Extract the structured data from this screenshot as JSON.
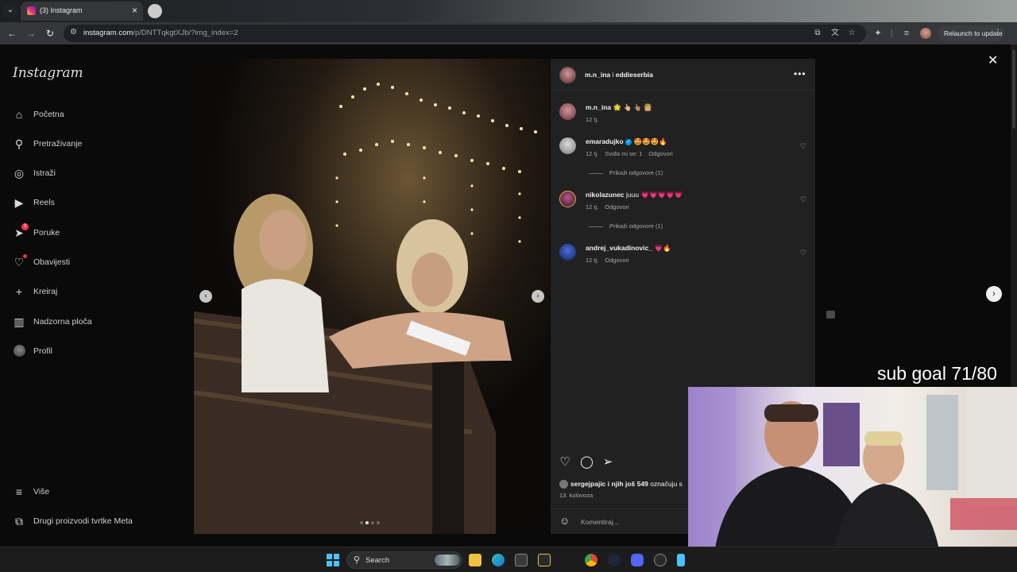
{
  "browser": {
    "tab_title": "(3) Instagram",
    "url_host": "instagram.com",
    "url_path": "/p/DNTTqkgtXJb/?img_index=2",
    "relaunch_label": "Relaunch to update"
  },
  "sidebar": {
    "logo": "Instagram",
    "items": [
      {
        "label": "Početna",
        "icon": "home-icon"
      },
      {
        "label": "Pretraživanje",
        "icon": "search-icon"
      },
      {
        "label": "Istraži",
        "icon": "compass-icon"
      },
      {
        "label": "Reels",
        "icon": "reels-icon"
      },
      {
        "label": "Poruke",
        "icon": "messenger-icon",
        "badge": "3"
      },
      {
        "label": "Obavijesti",
        "icon": "heart-icon"
      },
      {
        "label": "Kreiraj",
        "icon": "plus-icon"
      },
      {
        "label": "Nadzorna ploča",
        "icon": "dashboard-icon"
      },
      {
        "label": "Profil",
        "icon": "profile-icon"
      }
    ],
    "more_label": "Više",
    "meta_label": "Drugi proizvodi tvrtke Meta"
  },
  "post": {
    "author": "m.n_ina",
    "conjunction": "i",
    "collaborator": "eddieserbia",
    "caption_user": "m.n_ina",
    "caption_text": "🌟 👆🏼 👆🏽 👩🏼",
    "caption_time": "12 tj.",
    "carousel_index": 2,
    "carousel_total": 4,
    "comments": [
      {
        "user": "emaradujko",
        "text": "🤩🤩🤩🔥",
        "time": "12 tj.",
        "likes": "Sviđa mi se: 1",
        "reply": "Odgovori",
        "view_replies": "Prikaži odgovore (1)",
        "verified": true
      },
      {
        "user": "nikolazunec",
        "text": "juuu 💗💗💗💗💗",
        "time": "12 tj.",
        "reply": "Odgovori",
        "view_replies": "Prikaži odgovore (1)"
      },
      {
        "user": "andrej_vukadinovic_",
        "text": "💗🔥",
        "time": "12 tj.",
        "reply": "Odgovori"
      }
    ],
    "likes_user": "sergejpajic",
    "likes_mid": "i njih još",
    "likes_count": "549",
    "likes_tail": "označuju s",
    "date": "13. kolovoza",
    "comment_placeholder": "Komentiraj..."
  },
  "overlay": {
    "sub_goal": "sub goal 71/80"
  },
  "taskbar": {
    "search_label": "Search"
  },
  "colors": {
    "accent_blue": "#0095f6",
    "notification_red": "#ff3040",
    "windows_blue": "#4cc2ff"
  }
}
